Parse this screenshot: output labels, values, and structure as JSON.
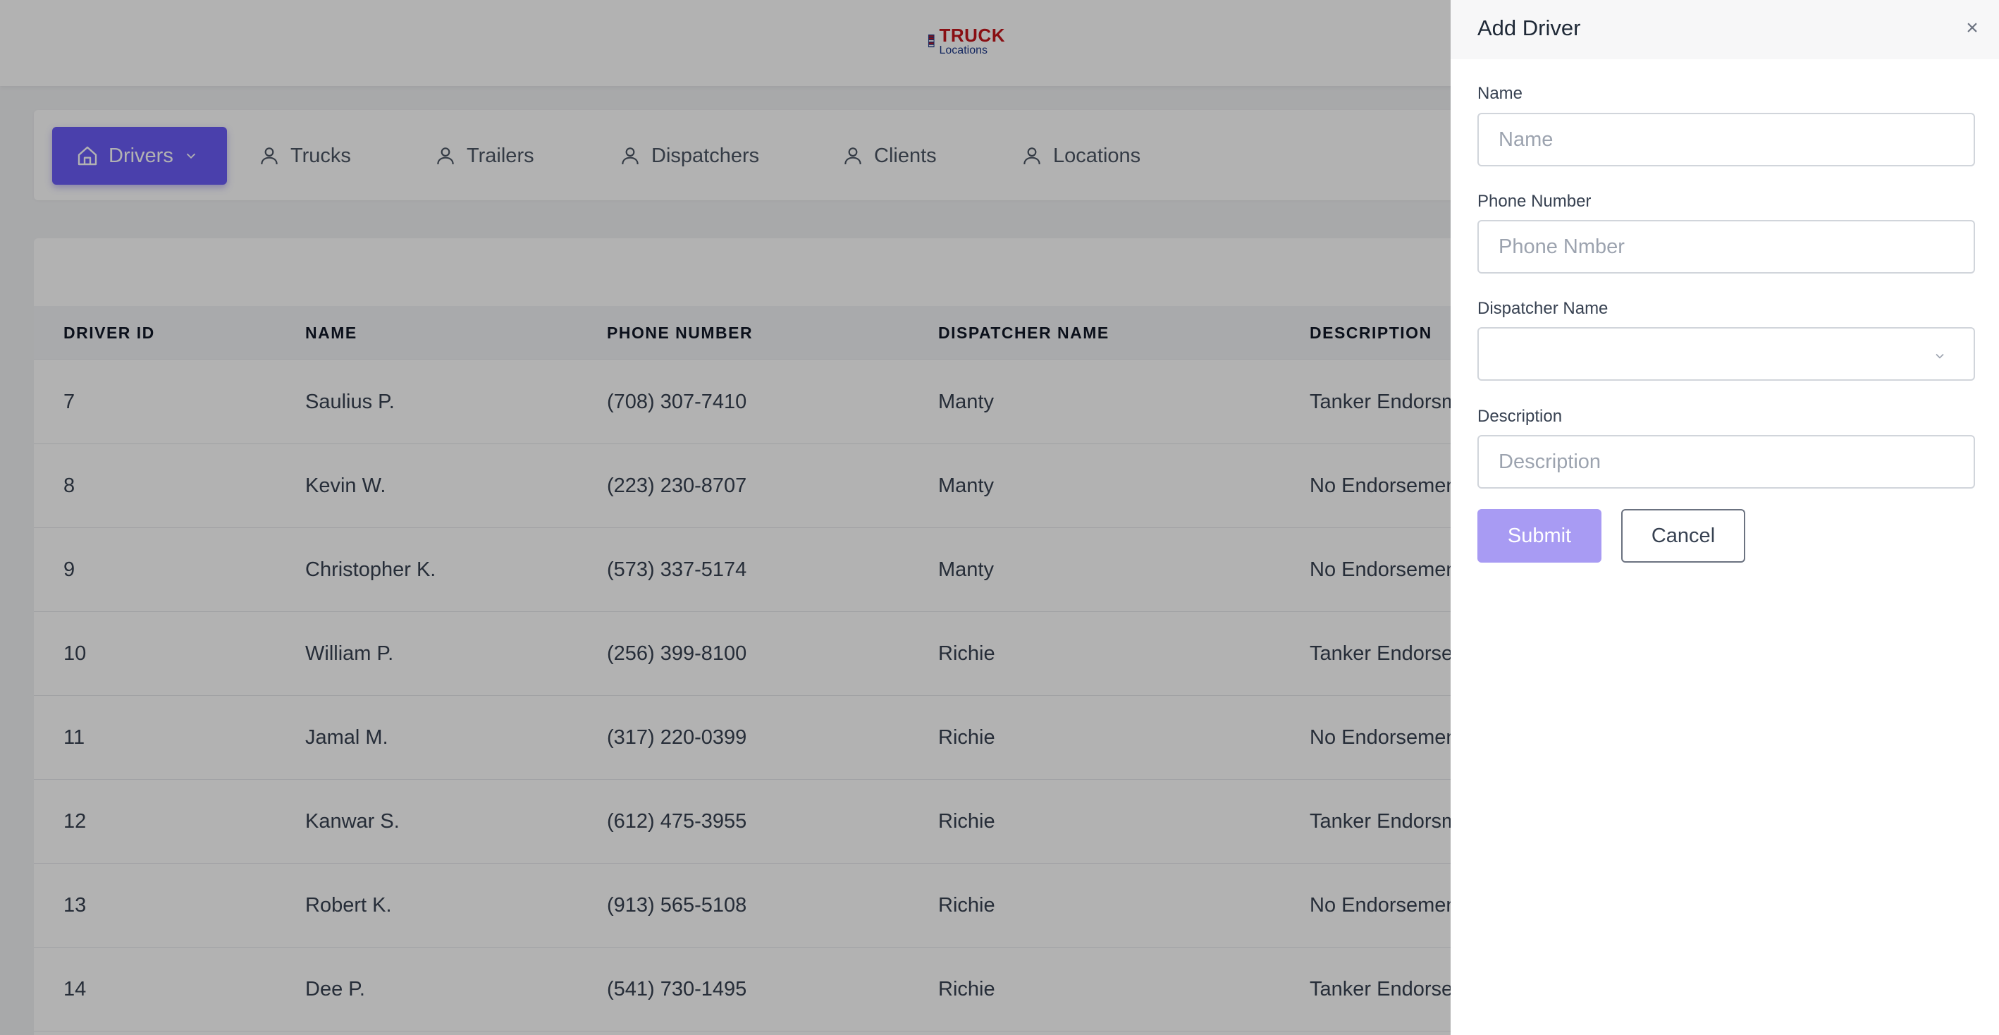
{
  "logo": {
    "line1": "TRUCK",
    "line2": "Locations"
  },
  "nav": {
    "items": [
      {
        "label": "Drivers",
        "icon": "home-icon",
        "active": true
      },
      {
        "label": "Trucks",
        "icon": "user-icon"
      },
      {
        "label": "Trailers",
        "icon": "user-icon"
      },
      {
        "label": "Dispatchers",
        "icon": "user-icon"
      },
      {
        "label": "Clients",
        "icon": "user-icon"
      },
      {
        "label": "Locations",
        "icon": "user-icon"
      }
    ]
  },
  "table": {
    "columns": [
      "DRIVER ID",
      "NAME",
      "PHONE NUMBER",
      "DISPATCHER NAME",
      "DESCRIPTION"
    ],
    "rows": [
      [
        "7",
        "Saulius P.",
        "(708) 307-7410",
        "Manty",
        "Tanker Endorsm"
      ],
      [
        "8",
        "Kevin W.",
        "(223) 230-8707",
        "Manty",
        "No Endorsemen"
      ],
      [
        "9",
        "Christopher K.",
        "(573) 337-5174",
        "Manty",
        "No Endorsemen"
      ],
      [
        "10",
        "William P.",
        "(256) 399-8100",
        "Richie",
        "Tanker Endorse"
      ],
      [
        "11",
        "Jamal M.",
        "(317) 220-0399",
        "Richie",
        "No Endorsemen"
      ],
      [
        "12",
        "Kanwar S.",
        "(612) 475-3955",
        "Richie",
        "Tanker Endorsm"
      ],
      [
        "13",
        "Robert K.",
        "(913) 565-5108",
        "Richie",
        "No Endorsemen"
      ],
      [
        "14",
        "Dee P.",
        "(541) 730-1495",
        "Richie",
        "Tanker Endorse"
      ]
    ]
  },
  "drawer": {
    "title": "Add Driver",
    "close": "×",
    "fields": {
      "name": {
        "label": "Name",
        "placeholder": "Name",
        "value": ""
      },
      "phone": {
        "label": "Phone Number",
        "placeholder": "Phone Nmber",
        "value": ""
      },
      "dispatcher": {
        "label": "Dispatcher Name",
        "value": ""
      },
      "description": {
        "label": "Description",
        "placeholder": "Description",
        "value": ""
      }
    },
    "submit_label": "Submit",
    "cancel_label": "Cancel"
  },
  "colors": {
    "accent": "#6b5cf6",
    "submit": "#a89bf3",
    "logo_red": "#c4161c",
    "logo_blue": "#1f3a8a"
  }
}
